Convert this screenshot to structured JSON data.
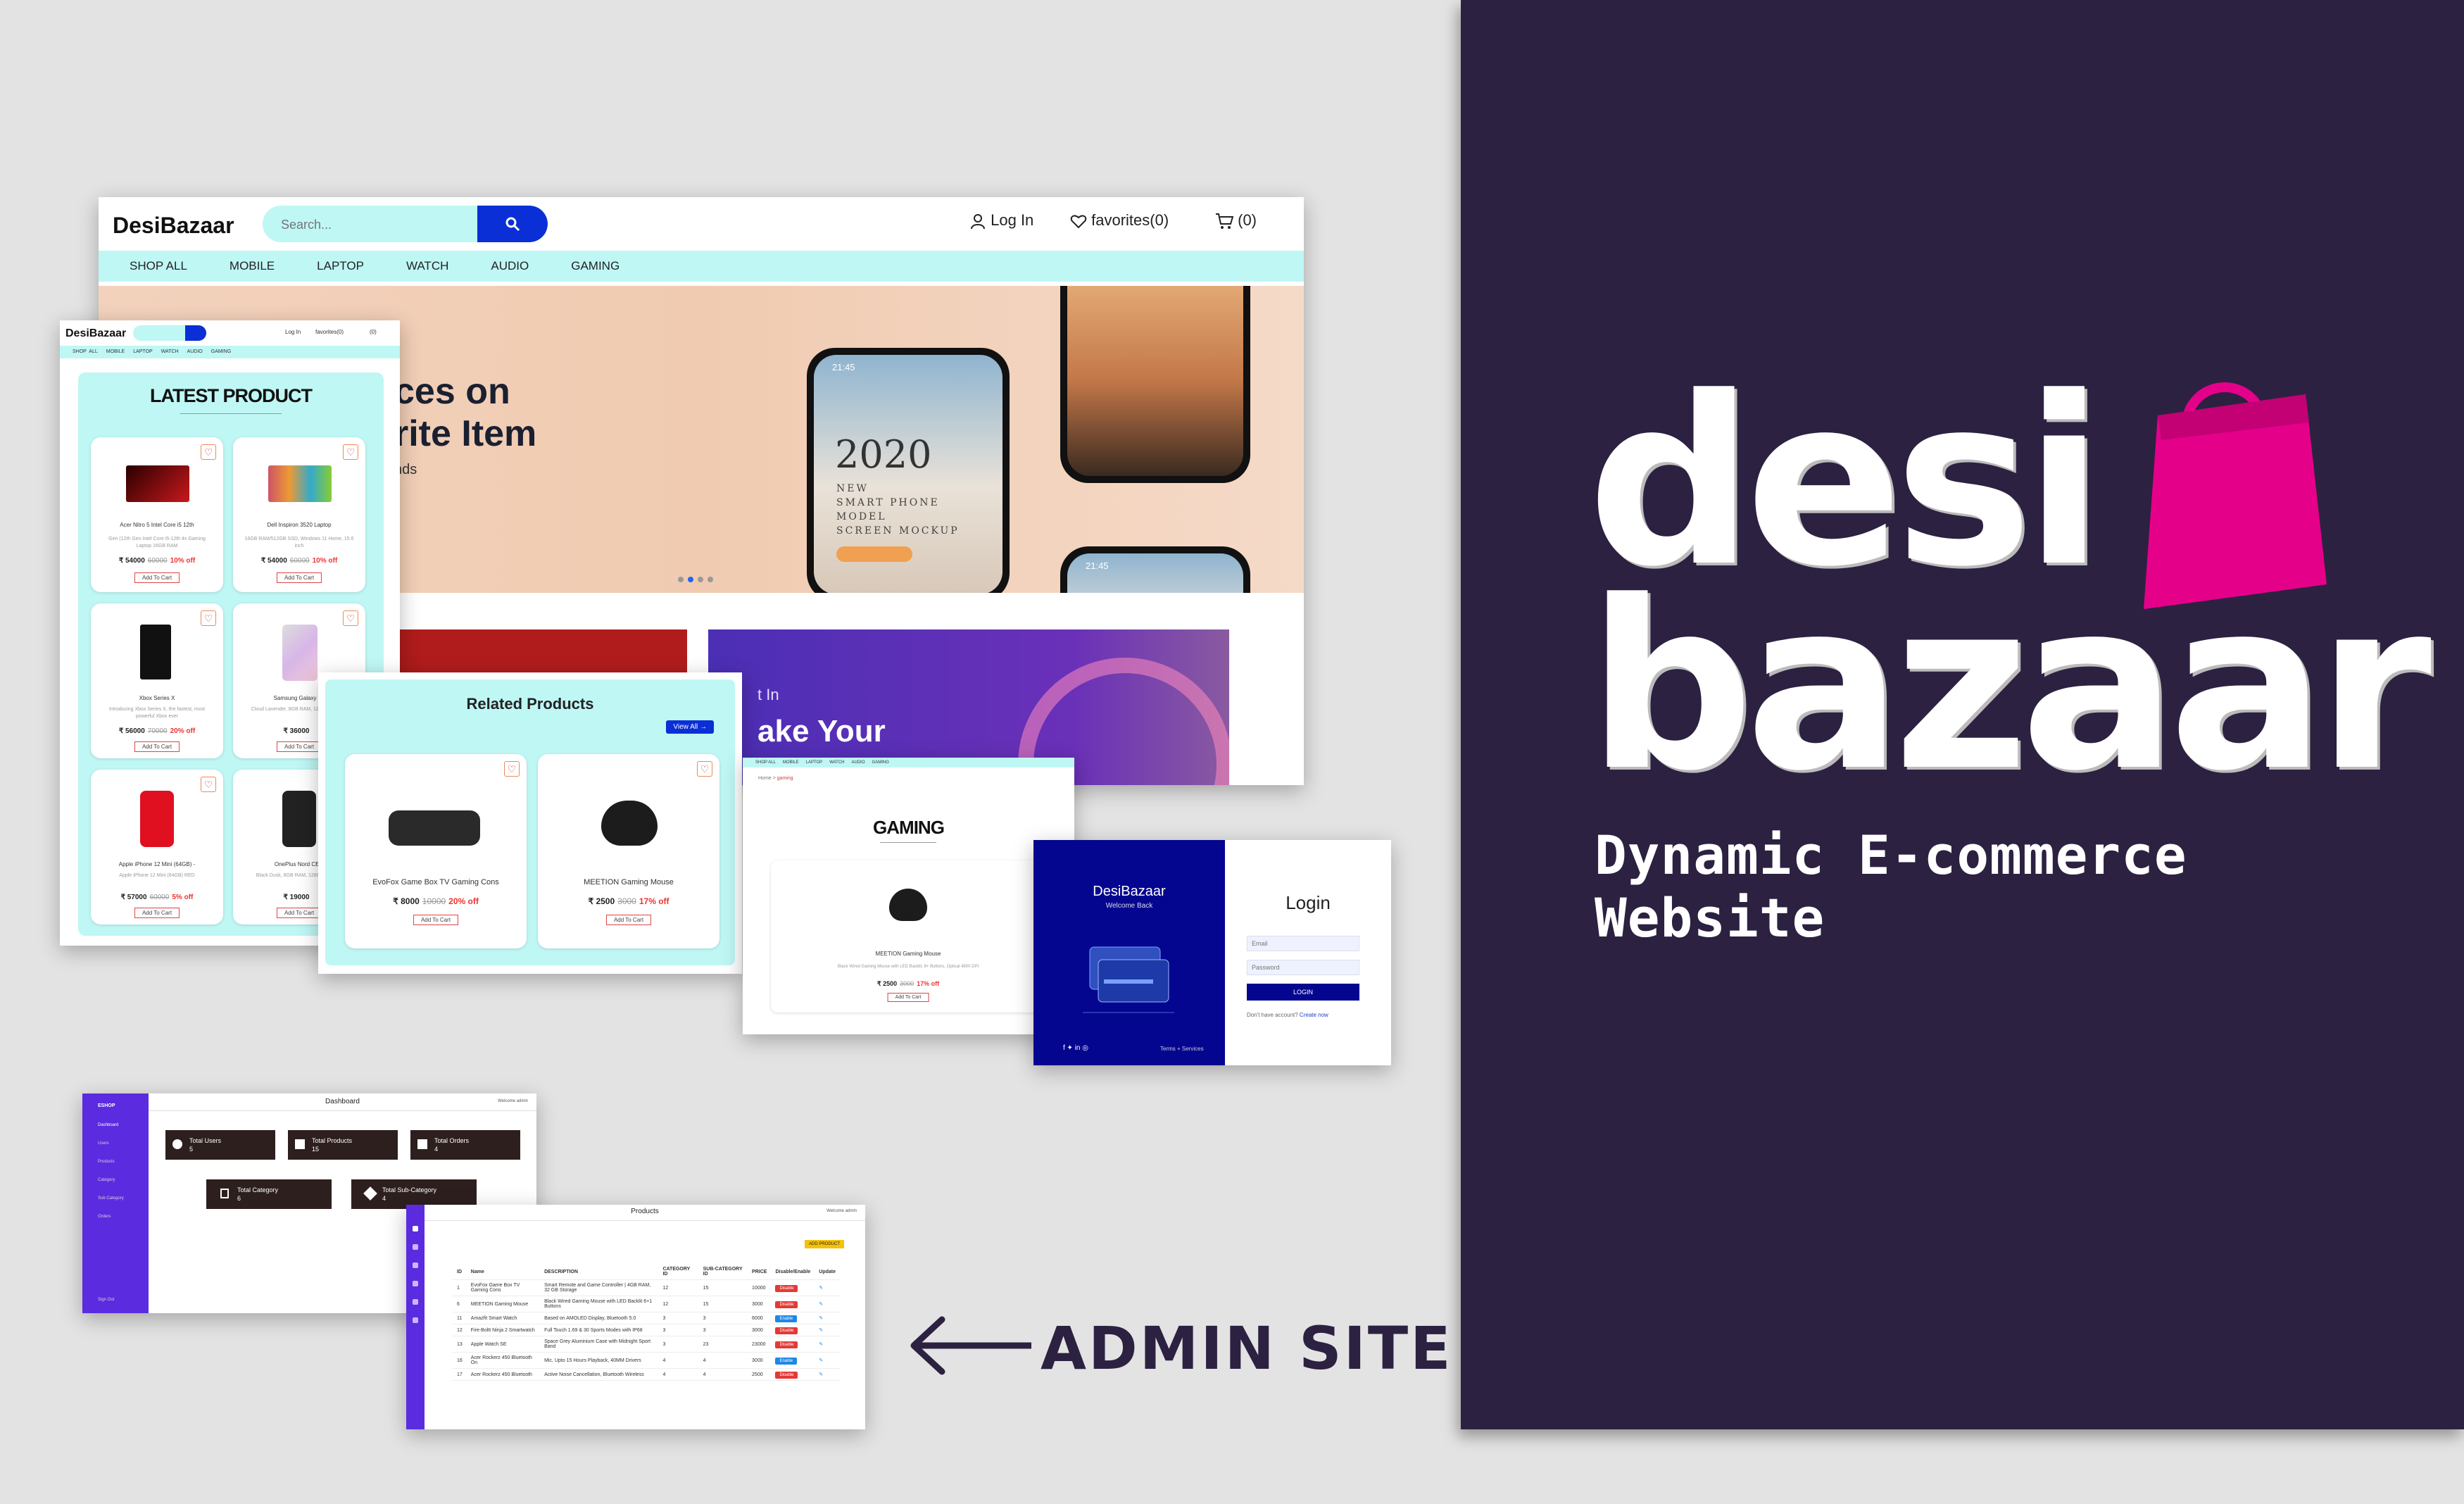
{
  "brand": {
    "logo_line1": "desi",
    "logo_line2": "bazaar",
    "tagline": "Dynamic E-commerce Website",
    "bag_color": "#e5008a",
    "panel_color": "#2c2141"
  },
  "site": {
    "name": "DesiBazaar",
    "search_placeholder": "Search...",
    "login": "Log In",
    "favorites": "favorites(0)",
    "cart": "(0)",
    "nav": [
      "SHOP ALL",
      "MOBILE",
      "LAPTOP",
      "WATCH",
      "AUDIO",
      "GAMING"
    ],
    "hero": {
      "line1": "ces on",
      "line2": "rite Item",
      "line3": "nds",
      "phone_title": "2020",
      "phone_sub1": "NEW",
      "phone_sub2": "SMART PHONE",
      "phone_sub3": "MODEL",
      "phone_sub4": "SCREEN MOCKUP",
      "time": "21:45"
    },
    "promo": {
      "line1": "t In",
      "line2": "ake Your"
    }
  },
  "latest": {
    "site_name": "DesiBazaar",
    "login": "Log In",
    "favorites": "favorites(0)",
    "cart": "(0)",
    "nav": [
      "SHOP ALL",
      "MOBILE",
      "LAPTOP",
      "WATCH",
      "AUDIO",
      "GAMING"
    ],
    "title": "LATEST PRODUCT",
    "products": [
      {
        "name": "Acer Nitro 5 Intel Core i5 12th",
        "desc": "Gen (12th Gen Intel Core i5-12th 4x Gaming Laptop 16GB RAM",
        "price": "₹ 54000",
        "old": "60000",
        "off": "10% off",
        "cart": "Add To Cart"
      },
      {
        "name": "Dell Inspiron 3520 Laptop",
        "desc": "16GB RAM/512GB SSD, Windows 11 Home, 15.6 inch",
        "price": "₹ 54000",
        "old": "60000",
        "off": "10% off",
        "cart": "Add To Cart"
      },
      {
        "name": "Xbox Series X",
        "desc": "Introducing Xbox Series X, the fastest, most powerful Xbox ever",
        "price": "₹ 56000",
        "old": "70000",
        "off": "20% off",
        "cart": "Add To Cart"
      },
      {
        "name": "Samsung Galaxy S2",
        "desc": "Cloud Lavender, 8GB RAM, 128GB Storage",
        "price": "₹ 36000",
        "old": "",
        "off": "",
        "cart": "Add To Cart"
      },
      {
        "name": "Apple iPhone 12 Mini (64GB) -",
        "desc": "Apple iPhone 12 Mini (64GB) RED",
        "price": "₹ 57000",
        "old": "60000",
        "off": "5% off",
        "cart": "Add To Cart"
      },
      {
        "name": "OnePlus Nord CE 2",
        "desc": "Black Dusk, 8GB RAM, 128GB Storage",
        "price": "₹ 19000",
        "old": "",
        "off": "",
        "cart": "Add To Cart"
      }
    ]
  },
  "related": {
    "title": "Related Products",
    "view_all": "View All →",
    "products": [
      {
        "name": "EvoFox Game Box TV Gaming Cons",
        "price": "₹ 8000",
        "old": "10000",
        "off": "20% off",
        "cart": "Add To Cart"
      },
      {
        "name": "MEETION Gaming Mouse",
        "price": "₹ 2500",
        "old": "3000",
        "off": "17% off",
        "cart": "Add To Cart"
      }
    ]
  },
  "gaming": {
    "nav": [
      "SHOP ALL",
      "MOBILE",
      "LAPTOP",
      "WATCH",
      "AUDIO",
      "GAMING"
    ],
    "breadcrumb_home": "Home",
    "breadcrumb_sep": ">",
    "breadcrumb_cur": "gaming",
    "title": "GAMING",
    "product": {
      "name": "MEETION Gaming Mouse",
      "desc": "Black Wired Gaming Mouse with LED Backlit, 6+ Buttons, Optical 4800 DPI",
      "price": "₹ 2500",
      "old": "3000",
      "off": "17% off",
      "cart": "Add To Cart"
    }
  },
  "login": {
    "brand": "DesiBazaar",
    "welcome": "Welcome Back",
    "terms": "Terms + Services",
    "title": "Login",
    "email_placeholder": "Email",
    "password_placeholder": "Password",
    "button": "LOGIN",
    "no_account": "Don't have account?",
    "create": "Create now",
    "panel_color": "#05068f"
  },
  "dashboard": {
    "logo": "ESHOP",
    "title": "Dashboard",
    "welcome": "Welcome admin",
    "sidebar": [
      "Dashboard",
      "Users",
      "Products",
      "Category",
      "Sub Category",
      "Orders"
    ],
    "logout": "Sign Out",
    "stats": [
      {
        "label": "Total Users",
        "value": "5"
      },
      {
        "label": "Total Products",
        "value": "15"
      },
      {
        "label": "Total Orders",
        "value": "4"
      },
      {
        "label": "Total Category",
        "value": "6"
      },
      {
        "label": "Total Sub-Category",
        "value": "4"
      }
    ]
  },
  "products_admin": {
    "title": "Products",
    "welcome": "Welcome admin",
    "add_button": "ADD PRODUCT",
    "columns": [
      "ID",
      "Name",
      "DESCRIPTION",
      "CATEGORY ID",
      "SUB-CATEGORY ID",
      "PRICE",
      "Disable/Enable",
      "Update"
    ],
    "rows": [
      {
        "id": "1",
        "name": "EvoFox Game Box TV Gaming Cons",
        "desc": "Smart Remote and Game Controller | 4GB RAM, 32 GB Storage",
        "cat": "12",
        "sub": "15",
        "price": "10000",
        "status": "Disable"
      },
      {
        "id": "6",
        "name": "MEETION Gaming Mouse",
        "desc": "Black Wired Gaming Mouse with LED Backlit 6+1 Buttons",
        "cat": "12",
        "sub": "15",
        "price": "3000",
        "status": "Disable"
      },
      {
        "id": "11",
        "name": "Amazfit Smart Watch",
        "desc": "Based on AMOLED Display, Bluetooth 5.0",
        "cat": "3",
        "sub": "3",
        "price": "6000",
        "status": "Enable"
      },
      {
        "id": "12",
        "name": "Fire-Boltt Ninja 2 Smartwatch",
        "desc": "Full Touch 1.69 & 30 Sports Modes with IP68",
        "cat": "3",
        "sub": "3",
        "price": "3000",
        "status": "Disable"
      },
      {
        "id": "13",
        "name": "Apple Watch SE",
        "desc": "Space Grey Aluminium Case with Midnight Sport Band",
        "cat": "3",
        "sub": "23",
        "price": "23000",
        "status": "Disable"
      },
      {
        "id": "16",
        "name": "Acer Rockerz 450 Bluetooth On",
        "desc": "Mic, Upto 15 Hours Playback, 40MM Drivers",
        "cat": "4",
        "sub": "4",
        "price": "3000",
        "status": "Enable"
      },
      {
        "id": "17",
        "name": "Acer Rockerz 450 Bluetooth",
        "desc": "Active Noise Cancellation, Bluetooth Wireless",
        "cat": "4",
        "sub": "4",
        "price": "2500",
        "status": "Disable"
      }
    ]
  },
  "admin_label": "ADMIN SITE"
}
